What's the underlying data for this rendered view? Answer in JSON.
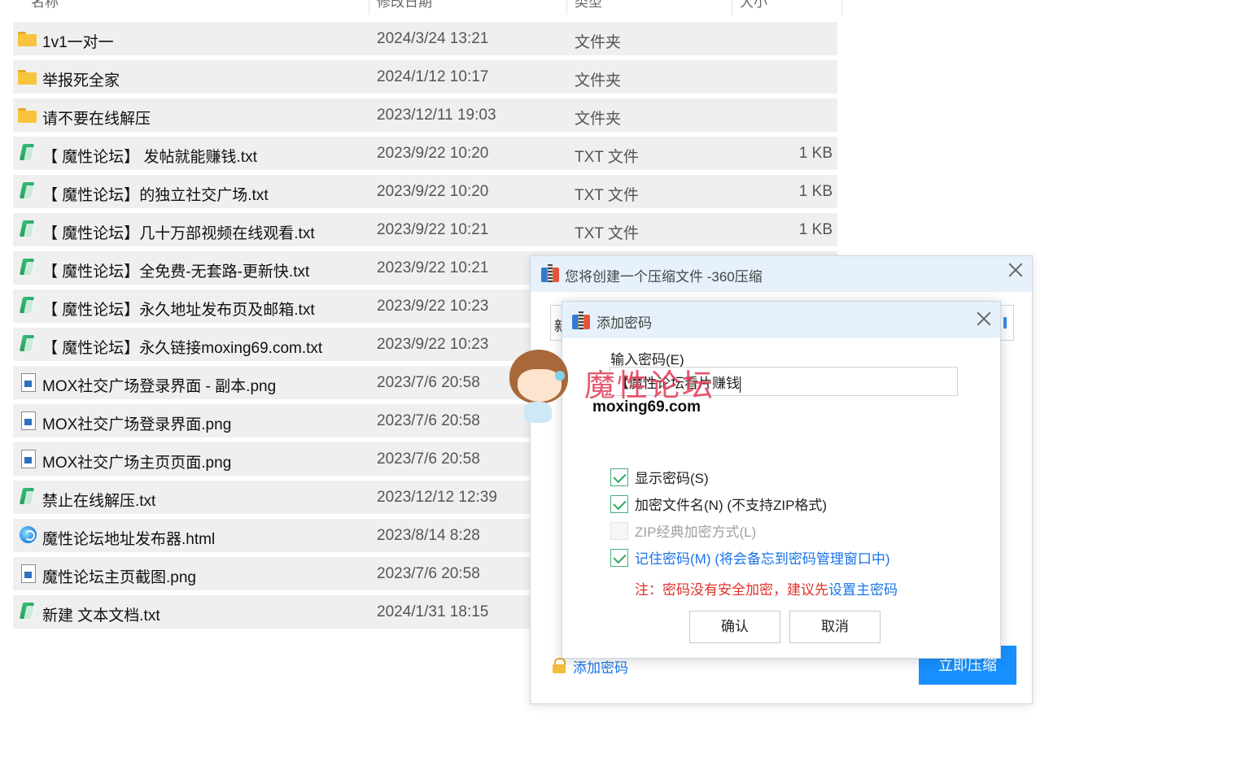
{
  "file_list": {
    "headers": {
      "name": "名称",
      "date": "修改日期",
      "type": "类型",
      "size": "大小"
    },
    "rows": [
      {
        "icon": "folder-icon",
        "name": "1v1一对一",
        "date": "2024/3/24 13:21",
        "type": "文件夹",
        "size": ""
      },
      {
        "icon": "folder-icon",
        "name": "举报死全家",
        "date": "2024/1/12 10:17",
        "type": "文件夹",
        "size": ""
      },
      {
        "icon": "folder-icon",
        "name": "请不要在线解压",
        "date": "2023/12/11 19:03",
        "type": "文件夹",
        "size": ""
      },
      {
        "icon": "txt-icon",
        "name": "【 魔性论坛】 发帖就能赚钱.txt",
        "date": "2023/9/22 10:20",
        "type": "TXT 文件",
        "size": "1 KB"
      },
      {
        "icon": "txt-icon",
        "name": "【 魔性论坛】的独立社交广场.txt",
        "date": "2023/9/22 10:20",
        "type": "TXT 文件",
        "size": "1 KB"
      },
      {
        "icon": "txt-icon",
        "name": "【 魔性论坛】几十万部视频在线观看.txt",
        "date": "2023/9/22 10:21",
        "type": "TXT 文件",
        "size": "1 KB"
      },
      {
        "icon": "txt-icon",
        "name": "【 魔性论坛】全免费-无套路-更新快.txt",
        "date": "2023/9/22 10:21",
        "type": "",
        "size": ""
      },
      {
        "icon": "txt-icon",
        "name": "【 魔性论坛】永久地址发布页及邮箱.txt",
        "date": "2023/9/22 10:23",
        "type": "",
        "size": ""
      },
      {
        "icon": "txt-icon",
        "name": "【 魔性论坛】永久链接moxing69.com.txt",
        "date": "2023/9/22 10:23",
        "type": "",
        "size": ""
      },
      {
        "icon": "png-icon",
        "name": "MOX社交广场登录界面 - 副本.png",
        "date": "2023/7/6 20:58",
        "type": "",
        "size": ""
      },
      {
        "icon": "png-icon",
        "name": "MOX社交广场登录界面.png",
        "date": "2023/7/6 20:58",
        "type": "",
        "size": ""
      },
      {
        "icon": "png-icon",
        "name": "MOX社交广场主页页面.png",
        "date": "2023/7/6 20:58",
        "type": "",
        "size": ""
      },
      {
        "icon": "txt-icon",
        "name": "禁止在线解压.txt",
        "date": "2023/12/12 12:39",
        "type": "",
        "size": ""
      },
      {
        "icon": "html-icon",
        "name": "魔性论坛地址发布器.html",
        "date": "2023/8/14 8:28",
        "type": "",
        "size": ""
      },
      {
        "icon": "png-icon",
        "name": "魔性论坛主页截图.png",
        "date": "2023/7/6 20:58",
        "type": "",
        "size": ""
      },
      {
        "icon": "txt-icon",
        "name": "新建 文本文档.txt",
        "date": "2024/1/31 18:15",
        "type": "",
        "size": ""
      }
    ]
  },
  "dialog_360": {
    "title": "您将创建一个压缩文件 -360压缩",
    "path_value": "新",
    "add_password_link": "添加密码",
    "compress_button": "立即压缩"
  },
  "password_dialog": {
    "title": "添加密码",
    "input_label": "输入密码(E)",
    "password_value": "【魔性论坛看片赚钱",
    "show_password": {
      "label": "显示密码(S)",
      "checked": true
    },
    "encrypt_names": {
      "label": "加密文件名(N) (不支持ZIP格式)",
      "checked": true
    },
    "zip_classic": {
      "label": "ZIP经典加密方式(L)",
      "checked": false,
      "disabled": true
    },
    "remember_password": {
      "label": "记住密码(M) (将会备忘到密码管理窗口中)",
      "checked": true
    },
    "note_prefix": "注：密码没有安全加密，建议先",
    "note_link": "设置主密码",
    "ok_button": "确认",
    "cancel_button": "取消"
  },
  "watermark": {
    "title": "魔性论坛",
    "site": "moxing69.com"
  },
  "colors": {
    "accent": "#1890ff",
    "titlebar": "#e6f1fb",
    "warning": "#e0302a",
    "check": "#2fa85e"
  }
}
